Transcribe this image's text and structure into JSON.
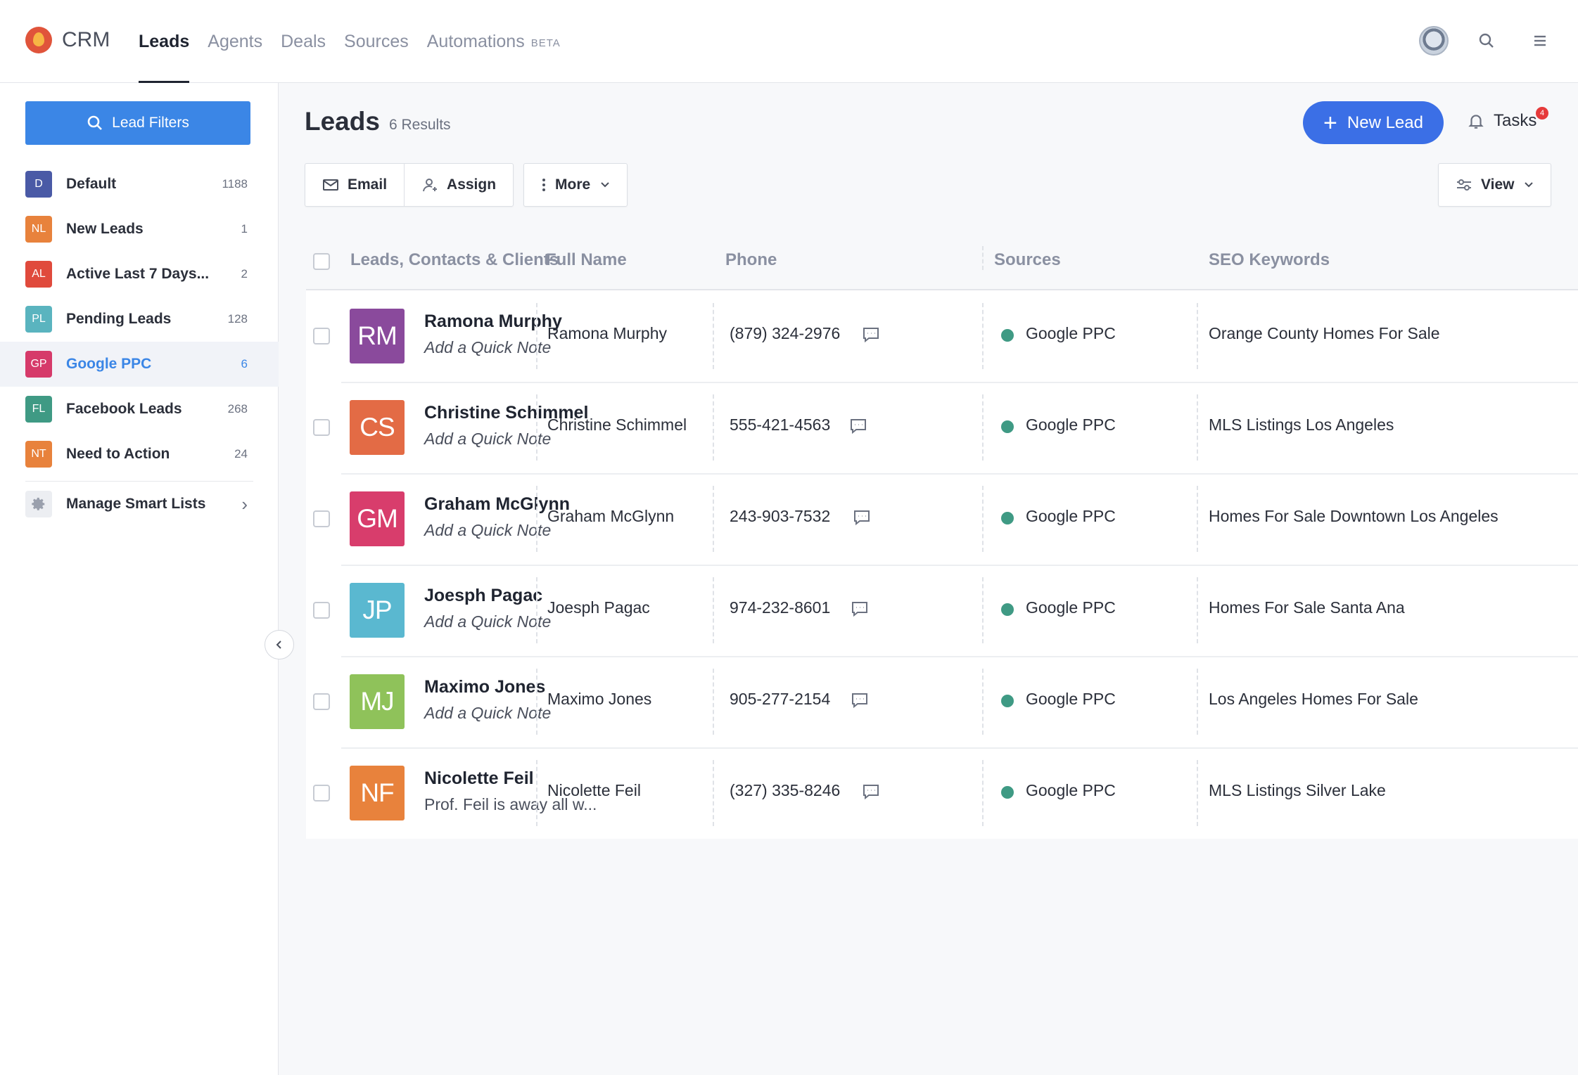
{
  "app": {
    "title": "CRM"
  },
  "nav": {
    "items": [
      {
        "label": "Leads",
        "active": true
      },
      {
        "label": "Agents"
      },
      {
        "label": "Deals"
      },
      {
        "label": "Sources"
      },
      {
        "label": "Automations",
        "badge": "BETA"
      }
    ]
  },
  "sidebar": {
    "filter_button": "Lead Filters",
    "lists": [
      {
        "badge": "D",
        "label": "Default",
        "count": "1188",
        "color": "#4a5aa6"
      },
      {
        "badge": "NL",
        "label": "New Leads",
        "count": "1",
        "color": "#e8823c"
      },
      {
        "badge": "AL",
        "label": "Active Last 7 Days...",
        "count": "2",
        "color": "#e04a3c"
      },
      {
        "badge": "PL",
        "label": "Pending Leads",
        "count": "128",
        "color": "#5ab4bf"
      },
      {
        "badge": "GP",
        "label": "Google PPC",
        "count": "6",
        "color": "#d63a6a",
        "active": true
      },
      {
        "badge": "FL",
        "label": "Facebook Leads",
        "count": "268",
        "color": "#3f9a84"
      },
      {
        "badge": "NT",
        "label": "Need to Action",
        "count": "24",
        "color": "#e8823c"
      }
    ],
    "manage": "Manage Smart Lists"
  },
  "main": {
    "title": "Leads",
    "results": "6 Results",
    "new_lead": "New Lead",
    "tasks": "Tasks",
    "tasks_count": "4",
    "toolbar": {
      "email": "Email",
      "assign": "Assign",
      "more": "More",
      "view": "View"
    }
  },
  "table": {
    "headers": [
      "Leads, Contacts & Clients",
      "Full Name",
      "Phone",
      "Sources",
      "SEO Keywords"
    ],
    "rows": [
      {
        "initials": "RM",
        "color": "#8a4a9c",
        "name": "Ramona Murphy",
        "note": "Add a Quick Note",
        "full_name": "Ramona Murphy",
        "phone": "(879) 324-2976",
        "source": "Google PPC",
        "keyword": "Orange County Homes For Sale"
      },
      {
        "initials": "CS",
        "color": "#e36b45",
        "name": "Christine Schimmel",
        "note": "Add a Quick Note",
        "full_name": "Christine Schimmel",
        "phone": "555-421-4563",
        "source": "Google PPC",
        "keyword": "MLS Listings Los Angeles"
      },
      {
        "initials": "GM",
        "color": "#d83d6c",
        "name": "Graham McGlynn",
        "note": "Add a Quick Note",
        "full_name": "Graham McGlynn",
        "phone": "243-903-7532",
        "source": "Google PPC",
        "keyword": "Homes For Sale Downtown Los Angeles"
      },
      {
        "initials": "JP",
        "color": "#5ab8d0",
        "name": "Joesph Pagac",
        "note": "Add a Quick Note",
        "full_name": "Joesph Pagac",
        "phone": "974-232-8601",
        "source": "Google PPC",
        "keyword": "Homes For Sale Santa Ana"
      },
      {
        "initials": "MJ",
        "color": "#8fc25a",
        "name": "Maximo Jones",
        "note": "Add a Quick Note",
        "full_name": "Maximo Jones",
        "phone": "905-277-2154",
        "source": "Google PPC",
        "keyword": "Los Angeles Homes For Sale"
      },
      {
        "initials": "NF",
        "color": "#e8823c",
        "name": "Nicolette Feil",
        "note": "Prof. Feil is away all w...",
        "note_plain": true,
        "full_name": "Nicolette Feil",
        "phone": "(327) 335-8246",
        "source": "Google PPC",
        "keyword": "MLS Listings Silver Lake"
      }
    ]
  }
}
